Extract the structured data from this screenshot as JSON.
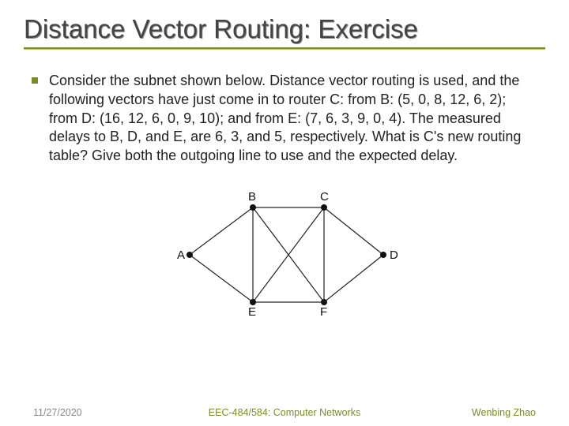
{
  "title": "Distance Vector Routing: Exercise",
  "bullet_text": "Consider the subnet shown below. Distance vector routing is used, and the following vectors have just come in to router C: from B: (5, 0, 8, 12, 6, 2); from D: (16, 12, 6, 0, 9, 10); and from E: (7, 6, 3, 9, 0, 4). The measured delays to B, D, and E, are 6, 3, and 5, respectively. What is C's new routing table? Give both the outgoing line to use and the expected delay.",
  "graph": {
    "nodes": [
      "A",
      "B",
      "C",
      "D",
      "E",
      "F"
    ],
    "edges": [
      [
        "A",
        "B"
      ],
      [
        "B",
        "C"
      ],
      [
        "C",
        "D"
      ],
      [
        "A",
        "E"
      ],
      [
        "B",
        "E"
      ],
      [
        "B",
        "F"
      ],
      [
        "C",
        "E"
      ],
      [
        "C",
        "F"
      ],
      [
        "D",
        "F"
      ],
      [
        "E",
        "F"
      ]
    ]
  },
  "footer": {
    "date": "11/27/2020",
    "course": "EEC-484/584: Computer Networks",
    "author": "Wenbing Zhao"
  }
}
